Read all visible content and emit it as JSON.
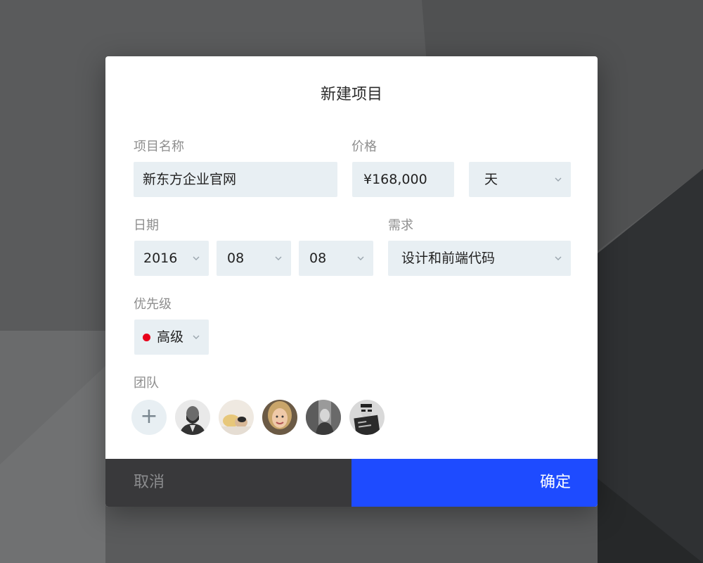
{
  "colors": {
    "accent": "#1e4bff",
    "field_bg": "#e8eff3",
    "priority_high": "#e8001a",
    "footer_dark": "#39393b"
  },
  "dialog": {
    "title": "新建项目",
    "project_name": {
      "label": "项目名称",
      "value": "新东方企业官网"
    },
    "price": {
      "label": "价格",
      "value": "¥168,000",
      "unit": "天"
    },
    "date": {
      "label": "日期",
      "year": "2016",
      "month": "08",
      "day": "08"
    },
    "requirement": {
      "label": "需求",
      "value": "设计和前端代码"
    },
    "priority": {
      "label": "优先级",
      "value": "高级"
    },
    "team": {
      "label": "团队",
      "add_symbol": "+",
      "members": [
        "avatar-1",
        "avatar-2",
        "avatar-3",
        "avatar-4",
        "avatar-5"
      ]
    },
    "cancel_label": "取消",
    "confirm_label": "确定"
  }
}
